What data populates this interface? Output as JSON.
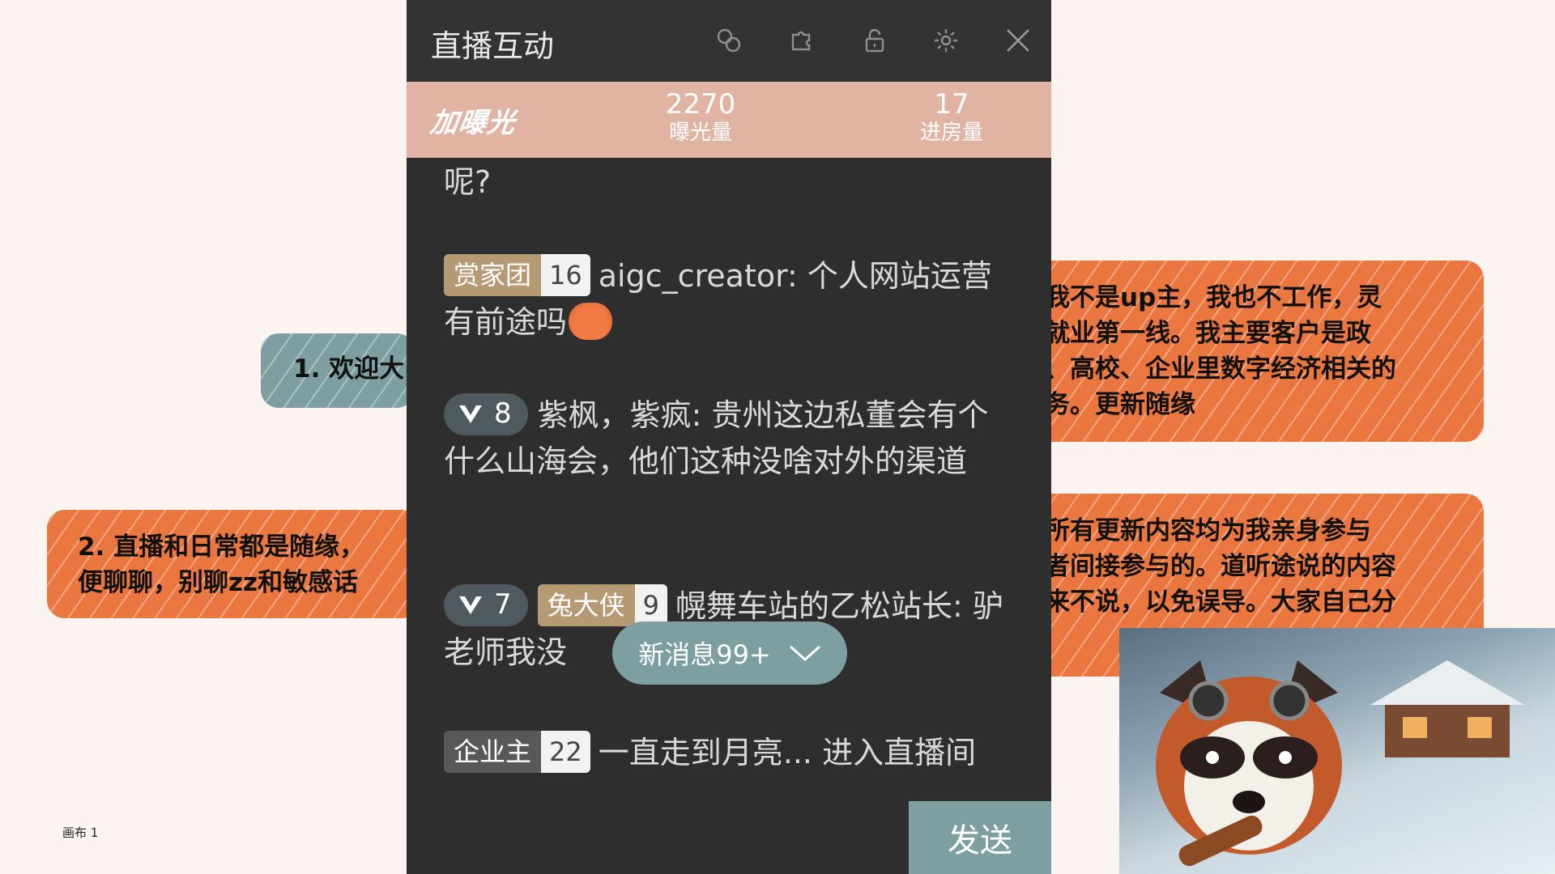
{
  "panel": {
    "title": "直播互动",
    "header_icons": [
      "link-icon",
      "puzzle-icon",
      "unlock-icon",
      "gear-icon",
      "close-icon"
    ]
  },
  "stats": {
    "boost_label": "加曝光",
    "exposure_value": "2270",
    "exposure_label": "曝光量",
    "entries_value": "17",
    "entries_label": "进房量"
  },
  "messages": {
    "partial_text": "呢?",
    "m1": {
      "badge": "赏家团",
      "level": "16",
      "user": "aigc_creator:",
      "text": " 个人网站运营有前途吗"
    },
    "m2": {
      "vip_level": "8",
      "user": "紫枫，紫疯:",
      "text": " 贵州这边私董会有个什么山海会，他们这种没啥对外的渠道"
    },
    "m3": {
      "vip_level": "7",
      "badge": "兔大侠",
      "level": "9",
      "user": "幌舞车站的乙松站长:",
      "text": " 驴老师我没"
    },
    "m4": {
      "badge": "企业主",
      "level": "22",
      "user": "一直走到月亮...",
      "text": " 进入直播间"
    }
  },
  "new_messages_label": "新消息99+",
  "send_label": "发送",
  "canvas": {
    "label": "画布 1",
    "note1": "1. 欢迎大",
    "note2": "2. 直播和日常都是随缘，\n便聊聊，别聊zz和敏感话",
    "note3": "我不是up主，我也不工作，灵\n就业第一线。我主要客户是政\n、高校、企业里数字经济相关的\n务。更新随缘",
    "note4": "所有更新内容均为我亲身参与\n者间接参与的。道听途说的内容\n来不说，以免误导。大家自己分"
  },
  "colors": {
    "panel_bg": "#2e2e2e",
    "stats_bg": "#e0b3a3",
    "accent_teal": "#7e9fa2",
    "note_orange": "#ea7640"
  }
}
